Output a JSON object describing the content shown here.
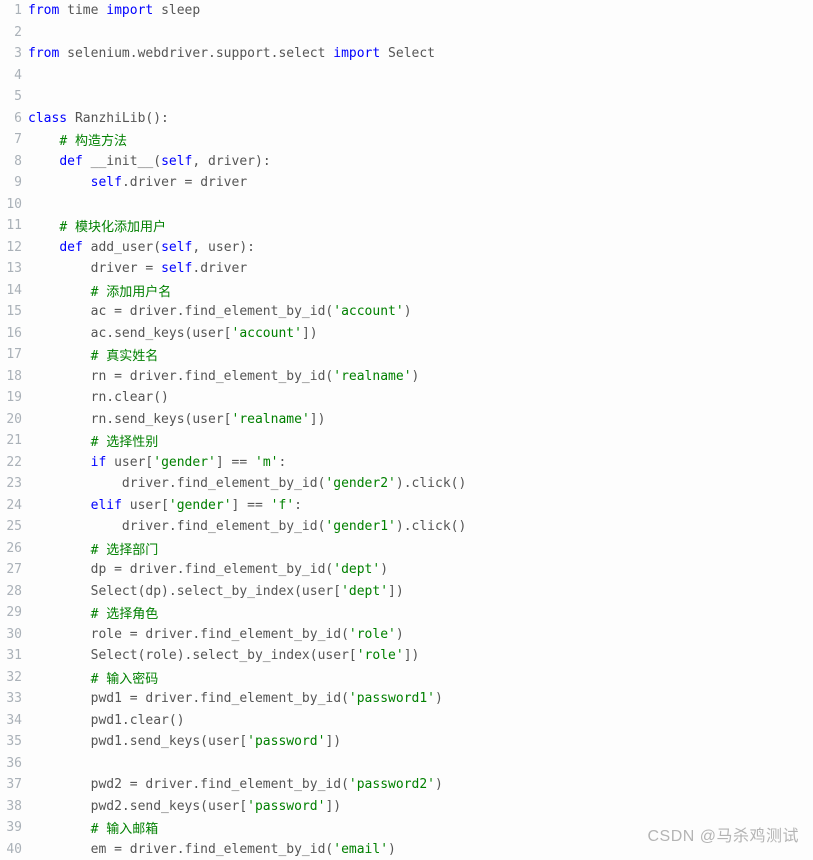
{
  "watermark": "CSDN @马杀鸡测试",
  "lines": [
    {
      "n": 1,
      "tokens": [
        {
          "c": "kw",
          "t": "from"
        },
        {
          "c": "",
          "t": " time "
        },
        {
          "c": "kw",
          "t": "import"
        },
        {
          "c": "",
          "t": " sleep"
        }
      ]
    },
    {
      "n": 2,
      "tokens": []
    },
    {
      "n": 3,
      "tokens": [
        {
          "c": "kw",
          "t": "from"
        },
        {
          "c": "",
          "t": " selenium.webdriver.support.select "
        },
        {
          "c": "kw",
          "t": "import"
        },
        {
          "c": "",
          "t": " Select"
        }
      ]
    },
    {
      "n": 4,
      "tokens": []
    },
    {
      "n": 5,
      "tokens": []
    },
    {
      "n": 6,
      "tokens": [
        {
          "c": "kw",
          "t": "class"
        },
        {
          "c": "",
          "t": " RanzhiLib():"
        }
      ]
    },
    {
      "n": 7,
      "tokens": [
        {
          "c": "",
          "t": "    "
        },
        {
          "c": "cm",
          "t": "# 构造方法"
        }
      ]
    },
    {
      "n": 8,
      "tokens": [
        {
          "c": "",
          "t": "    "
        },
        {
          "c": "kw",
          "t": "def"
        },
        {
          "c": "",
          "t": " __init__("
        },
        {
          "c": "kw-self",
          "t": "self"
        },
        {
          "c": "",
          "t": ", driver):"
        }
      ]
    },
    {
      "n": 9,
      "tokens": [
        {
          "c": "",
          "t": "        "
        },
        {
          "c": "kw-self",
          "t": "self"
        },
        {
          "c": "",
          "t": ".driver = driver"
        }
      ]
    },
    {
      "n": 10,
      "tokens": []
    },
    {
      "n": 11,
      "tokens": [
        {
          "c": "",
          "t": "    "
        },
        {
          "c": "cm",
          "t": "# 模块化添加用户"
        }
      ]
    },
    {
      "n": 12,
      "tokens": [
        {
          "c": "",
          "t": "    "
        },
        {
          "c": "kw",
          "t": "def"
        },
        {
          "c": "",
          "t": " add_user("
        },
        {
          "c": "kw-self",
          "t": "self"
        },
        {
          "c": "",
          "t": ", user):"
        }
      ]
    },
    {
      "n": 13,
      "tokens": [
        {
          "c": "",
          "t": "        driver = "
        },
        {
          "c": "kw-self",
          "t": "self"
        },
        {
          "c": "",
          "t": ".driver"
        }
      ]
    },
    {
      "n": 14,
      "tokens": [
        {
          "c": "",
          "t": "        "
        },
        {
          "c": "cm",
          "t": "# 添加用户名"
        }
      ]
    },
    {
      "n": 15,
      "tokens": [
        {
          "c": "",
          "t": "        ac = driver.find_element_by_id("
        },
        {
          "c": "str",
          "t": "'account'"
        },
        {
          "c": "",
          "t": ")"
        }
      ]
    },
    {
      "n": 16,
      "tokens": [
        {
          "c": "",
          "t": "        ac.send_keys(user["
        },
        {
          "c": "str",
          "t": "'account'"
        },
        {
          "c": "",
          "t": "])"
        }
      ]
    },
    {
      "n": 17,
      "tokens": [
        {
          "c": "",
          "t": "        "
        },
        {
          "c": "cm",
          "t": "# 真实姓名"
        }
      ]
    },
    {
      "n": 18,
      "tokens": [
        {
          "c": "",
          "t": "        rn = driver.find_element_by_id("
        },
        {
          "c": "str",
          "t": "'realname'"
        },
        {
          "c": "",
          "t": ")"
        }
      ]
    },
    {
      "n": 19,
      "tokens": [
        {
          "c": "",
          "t": "        rn.clear()"
        }
      ]
    },
    {
      "n": 20,
      "tokens": [
        {
          "c": "",
          "t": "        rn.send_keys(user["
        },
        {
          "c": "str",
          "t": "'realname'"
        },
        {
          "c": "",
          "t": "])"
        }
      ]
    },
    {
      "n": 21,
      "tokens": [
        {
          "c": "",
          "t": "        "
        },
        {
          "c": "cm",
          "t": "# 选择性别"
        }
      ]
    },
    {
      "n": 22,
      "tokens": [
        {
          "c": "",
          "t": "        "
        },
        {
          "c": "kw",
          "t": "if"
        },
        {
          "c": "",
          "t": " user["
        },
        {
          "c": "str",
          "t": "'gender'"
        },
        {
          "c": "",
          "t": "] == "
        },
        {
          "c": "str",
          "t": "'m'"
        },
        {
          "c": "",
          "t": ":"
        }
      ]
    },
    {
      "n": 23,
      "tokens": [
        {
          "c": "",
          "t": "            driver.find_element_by_id("
        },
        {
          "c": "str",
          "t": "'gender2'"
        },
        {
          "c": "",
          "t": ").click()"
        }
      ]
    },
    {
      "n": 24,
      "tokens": [
        {
          "c": "",
          "t": "        "
        },
        {
          "c": "kw",
          "t": "elif"
        },
        {
          "c": "",
          "t": " user["
        },
        {
          "c": "str",
          "t": "'gender'"
        },
        {
          "c": "",
          "t": "] == "
        },
        {
          "c": "str",
          "t": "'f'"
        },
        {
          "c": "",
          "t": ":"
        }
      ]
    },
    {
      "n": 25,
      "tokens": [
        {
          "c": "",
          "t": "            driver.find_element_by_id("
        },
        {
          "c": "str",
          "t": "'gender1'"
        },
        {
          "c": "",
          "t": ").click()"
        }
      ]
    },
    {
      "n": 26,
      "tokens": [
        {
          "c": "",
          "t": "        "
        },
        {
          "c": "cm",
          "t": "# 选择部门"
        }
      ]
    },
    {
      "n": 27,
      "tokens": [
        {
          "c": "",
          "t": "        dp = driver.find_element_by_id("
        },
        {
          "c": "str",
          "t": "'dept'"
        },
        {
          "c": "",
          "t": ")"
        }
      ]
    },
    {
      "n": 28,
      "tokens": [
        {
          "c": "",
          "t": "        Select(dp).select_by_index(user["
        },
        {
          "c": "str",
          "t": "'dept'"
        },
        {
          "c": "",
          "t": "])"
        }
      ]
    },
    {
      "n": 29,
      "tokens": [
        {
          "c": "",
          "t": "        "
        },
        {
          "c": "cm",
          "t": "# 选择角色"
        }
      ]
    },
    {
      "n": 30,
      "tokens": [
        {
          "c": "",
          "t": "        role = driver.find_element_by_id("
        },
        {
          "c": "str",
          "t": "'role'"
        },
        {
          "c": "",
          "t": ")"
        }
      ]
    },
    {
      "n": 31,
      "tokens": [
        {
          "c": "",
          "t": "        Select(role).select_by_index(user["
        },
        {
          "c": "str",
          "t": "'role'"
        },
        {
          "c": "",
          "t": "])"
        }
      ]
    },
    {
      "n": 32,
      "tokens": [
        {
          "c": "",
          "t": "        "
        },
        {
          "c": "cm",
          "t": "# 输入密码"
        }
      ]
    },
    {
      "n": 33,
      "tokens": [
        {
          "c": "",
          "t": "        pwd1 = driver.find_element_by_id("
        },
        {
          "c": "str",
          "t": "'password1'"
        },
        {
          "c": "",
          "t": ")"
        }
      ]
    },
    {
      "n": 34,
      "tokens": [
        {
          "c": "",
          "t": "        pwd1.clear()"
        }
      ]
    },
    {
      "n": 35,
      "tokens": [
        {
          "c": "",
          "t": "        pwd1.send_keys(user["
        },
        {
          "c": "str",
          "t": "'password'"
        },
        {
          "c": "",
          "t": "])"
        }
      ]
    },
    {
      "n": 36,
      "tokens": []
    },
    {
      "n": 37,
      "tokens": [
        {
          "c": "",
          "t": "        pwd2 = driver.find_element_by_id("
        },
        {
          "c": "str",
          "t": "'password2'"
        },
        {
          "c": "",
          "t": ")"
        }
      ]
    },
    {
      "n": 38,
      "tokens": [
        {
          "c": "",
          "t": "        pwd2.send_keys(user["
        },
        {
          "c": "str",
          "t": "'password'"
        },
        {
          "c": "",
          "t": "])"
        }
      ]
    },
    {
      "n": 39,
      "tokens": [
        {
          "c": "",
          "t": "        "
        },
        {
          "c": "cm",
          "t": "# 输入邮箱"
        }
      ]
    },
    {
      "n": 40,
      "tokens": [
        {
          "c": "",
          "t": "        em = driver.find_element_by_id("
        },
        {
          "c": "str",
          "t": "'email'"
        },
        {
          "c": "",
          "t": ")"
        }
      ]
    }
  ]
}
